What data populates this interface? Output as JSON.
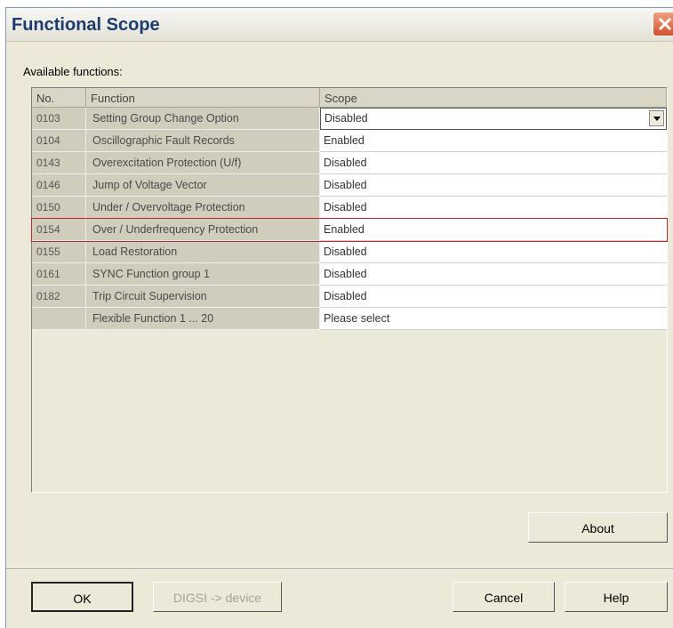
{
  "window": {
    "title": "Functional Scope"
  },
  "grid": {
    "label": "Available functions:",
    "columns": [
      "No.",
      "Function",
      "Scope"
    ],
    "rows": [
      {
        "no": "0103",
        "function": "Setting Group Change Option",
        "scope": "Disabled"
      },
      {
        "no": "0104",
        "function": "Oscillographic Fault Records",
        "scope": "Enabled"
      },
      {
        "no": "0143",
        "function": "Overexcitation Protection (U/f)",
        "scope": "Disabled"
      },
      {
        "no": "0146",
        "function": "Jump of Voltage Vector",
        "scope": "Disabled"
      },
      {
        "no": "0150",
        "function": "Under / Overvoltage Protection",
        "scope": "Disabled"
      },
      {
        "no": "0154",
        "function": "Over / Underfrequency Protection",
        "scope": "Enabled"
      },
      {
        "no": "0155",
        "function": "Load Restoration",
        "scope": "Disabled"
      },
      {
        "no": "0161",
        "function": "SYNC Function group 1",
        "scope": "Disabled"
      },
      {
        "no": "0182",
        "function": "Trip Circuit Supervision",
        "scope": "Disabled"
      },
      {
        "no": "",
        "function": "Flexible Function 1 ... 20",
        "scope": "Please select"
      }
    ]
  },
  "buttons": {
    "about": "About",
    "ok": "OK",
    "digsi": "DIGSI -> device",
    "cancel": "Cancel",
    "help": "Help"
  },
  "colors": {
    "highlight": "#c0272d",
    "title": "#1d3b6e"
  },
  "icons": {
    "close": "close-icon",
    "dropdown": "chevron-down-icon"
  }
}
